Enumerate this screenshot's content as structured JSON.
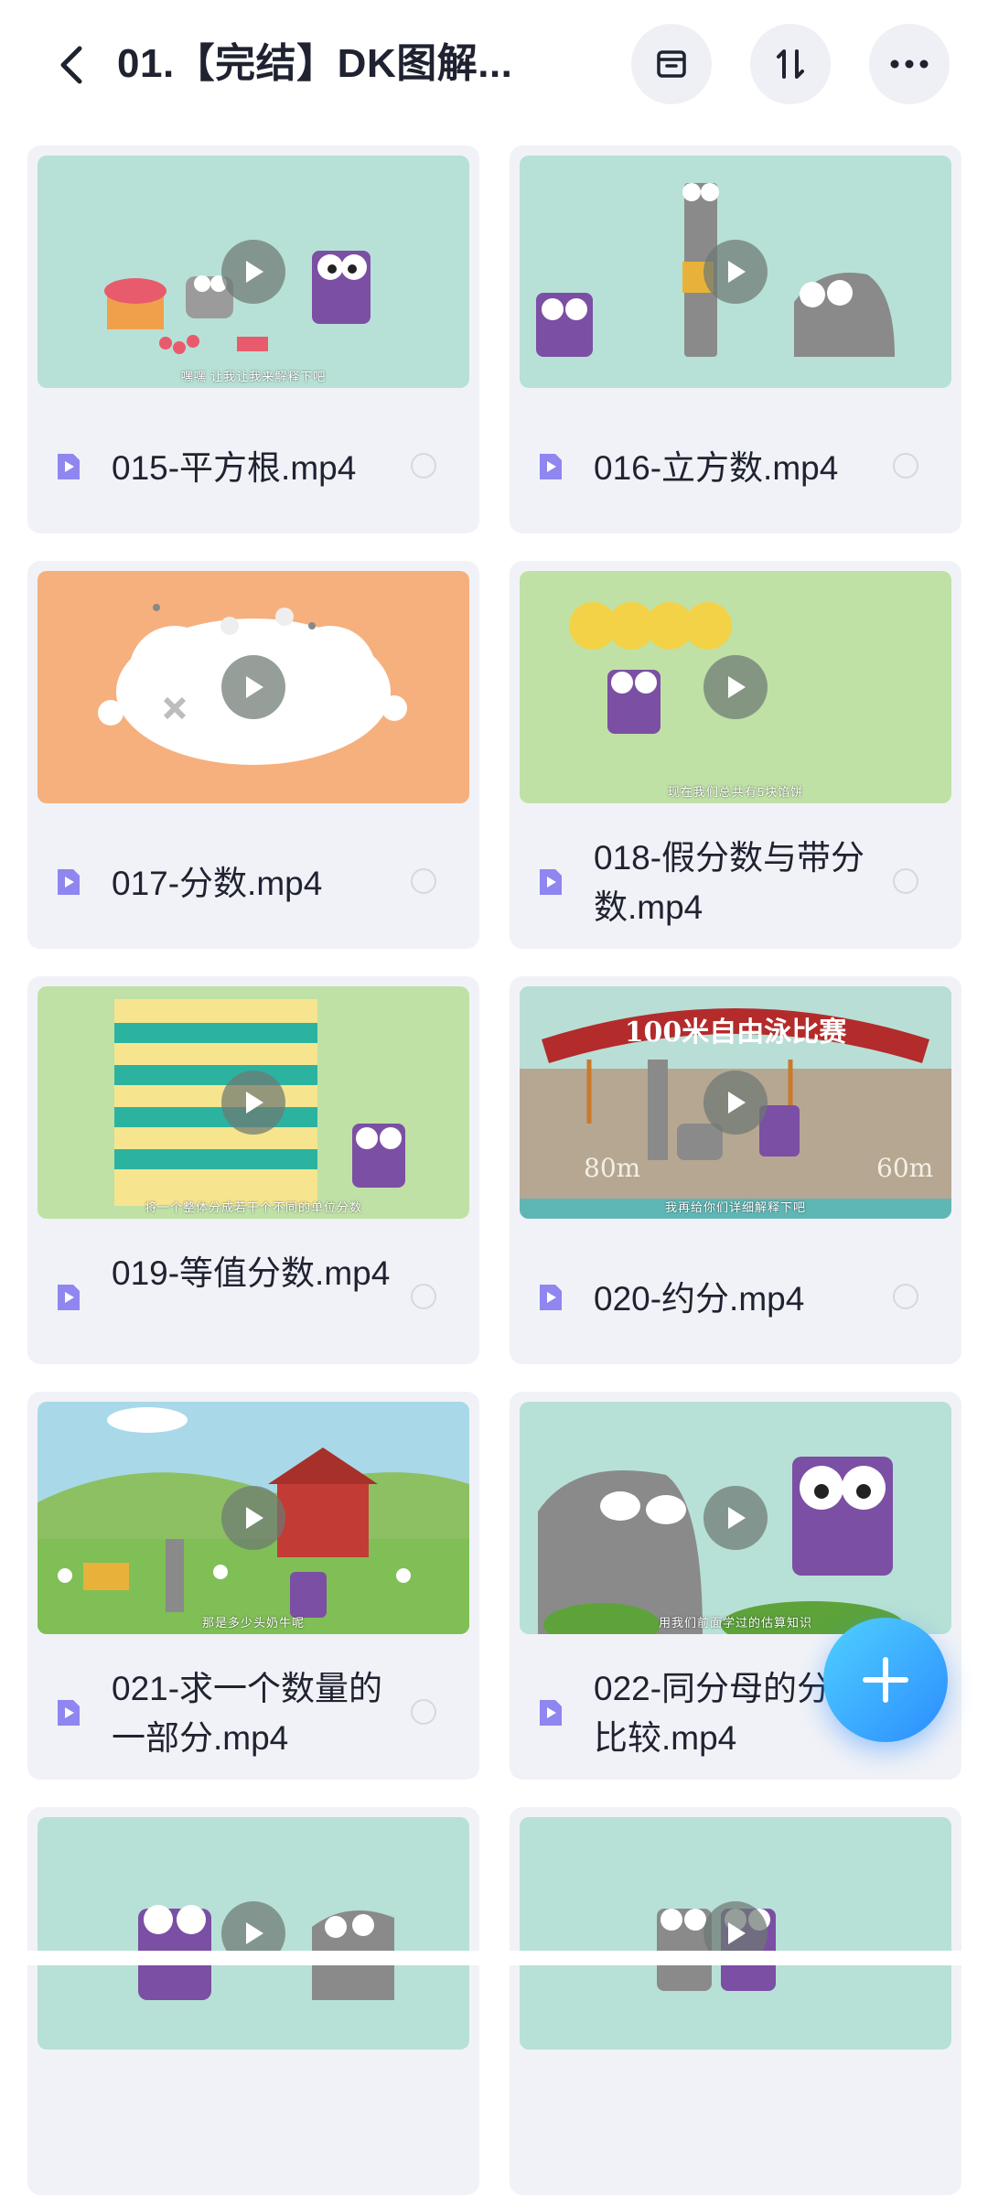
{
  "header": {
    "title": "01.【完结】DK图解...",
    "back_icon": "chevron-left-icon",
    "actions": [
      "archive-icon",
      "sort-icon",
      "more-icon"
    ]
  },
  "files": [
    {
      "name": "015-平方根.mp4",
      "thumb_bg": "#b7e1d6",
      "subtitle": "嘿嘿 让我让我来解释下吧"
    },
    {
      "name": "016-立方数.mp4",
      "thumb_bg": "#b7e1d6",
      "subtitle": ""
    },
    {
      "name": "017-分数.mp4",
      "thumb_bg": "#f5b07e",
      "subtitle": ""
    },
    {
      "name": "018-假分数与带分数.mp4",
      "thumb_bg": "#bfe1a6",
      "subtitle": "现在我们总共有5块馅饼"
    },
    {
      "name": "019-等值分数.mp4",
      "thumb_bg": "#bfe1a6",
      "subtitle": "将一个整体分成若干个不同的单位分数"
    },
    {
      "name": "020-约分.mp4",
      "thumb_bg": "#b6a792",
      "subtitle": "我再给你们详细解释下吧",
      "banner": "100米自由泳比赛",
      "labels": [
        "80m",
        "60m"
      ]
    },
    {
      "name": "021-求一个数量的一部分.mp4",
      "thumb_bg": "#a9d9e8",
      "subtitle": "那是多少头奶牛呢"
    },
    {
      "name": "022-同分母的分数比较.mp4",
      "thumb_bg": "#b7e1d6",
      "subtitle": "用我们前面学过的估算知识"
    },
    {
      "name": "",
      "thumb_bg": "#b7e1d6",
      "subtitle": ""
    },
    {
      "name": "",
      "thumb_bg": "#b7e1d6",
      "subtitle": ""
    }
  ],
  "fab": {
    "icon": "plus-icon"
  },
  "colors": {
    "accent": "#2c8dff",
    "file_icon": "#8f86f0",
    "card_bg": "#f1f2f7"
  }
}
